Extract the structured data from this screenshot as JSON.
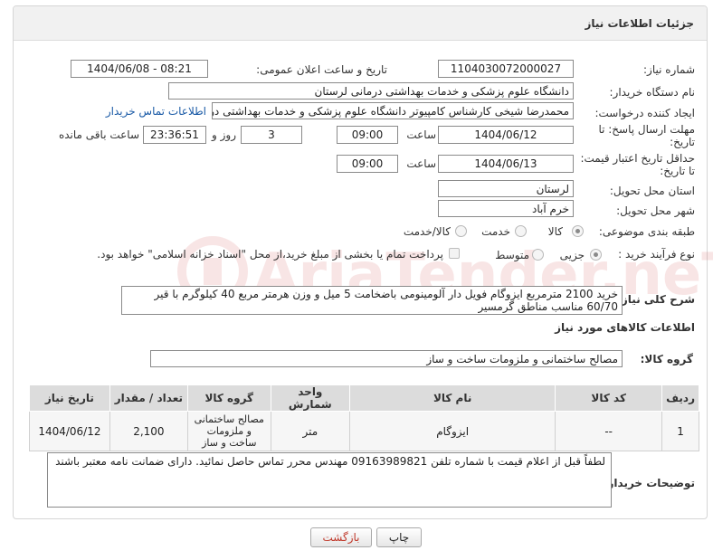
{
  "panel_title": "جزئیات اطلاعات نیاز",
  "fields": {
    "need_number_label": "شماره نیاز:",
    "need_number": "1104030072000027",
    "announce_label": "تاریخ و ساعت اعلان عمومی:",
    "announce_value": "1404/06/08 - 08:21",
    "buyer_org_label": "نام دستگاه خریدار:",
    "buyer_org": "دانشگاه علوم پزشکی و خدمات بهداشتی درمانی لرستان",
    "requester_label": "ایجاد کننده درخواست:",
    "requester": "محمدرضا شیخی کارشناس کامپیوتر دانشگاه علوم پزشکی و خدمات بهداشتی درمانی لرستان",
    "buyer_contact_link": "اطلاعات تماس خریدار",
    "reply_deadline_label_1": "مهلت ارسال پاسخ: تا",
    "reply_deadline_label_2": "تاریخ:",
    "reply_date": "1404/06/12",
    "time_word": "ساعت",
    "reply_time": "09:00",
    "days_value": "3",
    "days_word": "روز و",
    "remaining_value": "23:36:51",
    "remaining_word": "ساعت باقی مانده",
    "price_valid_label_1": "حداقل تاریخ اعتبار قیمت:",
    "price_valid_label_2": "تا تاریخ:",
    "price_valid_date": "1404/06/13",
    "price_valid_time": "09:00",
    "province_label": "استان محل تحویل:",
    "province": "لرستان",
    "city_label": "شهر محل تحویل:",
    "city": "خرم آباد",
    "category_label": "طبقه بندی موضوعی:",
    "category_options": [
      "کالا",
      "خدمت",
      "کالا/خدمت"
    ],
    "category_selected": "کالا",
    "process_label": "نوع فرآیند خرید :",
    "process_options": [
      "جزیی",
      "متوسط"
    ],
    "process_selected": "جزیی",
    "payment_note": "پرداخت تمام یا بخشی از مبلغ خرید،از محل \"اسناد خزانه اسلامی\" خواهد بود."
  },
  "description": {
    "label": "شرح کلی نیاز:",
    "text": "خرید 2100 مترمربع ایزوگام فویل دار آلومینومی باضخامت 5 میل و وزن هرمتر مربع 40 کیلوگرم با قیر 60/70 مناسب مناطق گرمسیر"
  },
  "goods_section_title": "اطلاعات کالاهای مورد نیاز",
  "goods_group_label": "گروه کالا:",
  "goods_group_value": "مصالح ساختمانی و ملزومات ساخت و ساز",
  "table": {
    "headers": [
      "ردیف",
      "کد کالا",
      "نام کالا",
      "واحد شمارش",
      "گروه کالا",
      "تعداد / مقدار",
      "تاریخ نیاز"
    ],
    "rows": [
      [
        "1",
        "--",
        "ایزوگام",
        "متر",
        "مصالح ساختمانی و ملزومات ساخت و ساز",
        "2,100",
        "1404/06/12"
      ]
    ]
  },
  "buyer_notes_label": "توضیحات خریدار:",
  "buyer_notes": "لطفاً قبل از اعلام قیمت با شماره تلفن 09163989821 مهندس محرر تماس حاصل نمائید. دارای ضمانت نامه معتبر باشند",
  "buttons": {
    "print": "چاپ",
    "back": "بازگشت"
  },
  "watermark": "AriaTender.neT",
  "colors": {
    "back_button_text": "#c0392b",
    "link": "#1a5aa6",
    "watermark": "#d04040"
  }
}
